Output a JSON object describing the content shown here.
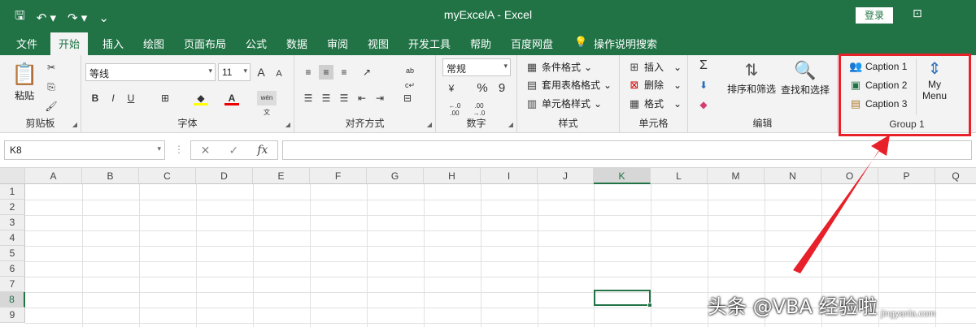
{
  "titlebar": {
    "title": "myExcelA  -  Excel",
    "login_label": "登录"
  },
  "tabs": [
    "文件",
    "开始",
    "插入",
    "绘图",
    "页面布局",
    "公式",
    "数据",
    "审阅",
    "视图",
    "开发工具",
    "帮助",
    "百度网盘",
    "操作说明搜索"
  ],
  "active_tab": "开始",
  "ribbon": {
    "clipboard": {
      "paste": "粘贴",
      "label": "剪贴板"
    },
    "font": {
      "name": "等线",
      "size": "11",
      "label": "字体",
      "grow": "A",
      "shrink": "A",
      "bold": "B",
      "italic": "I",
      "underline": "U",
      "phonetic": "wén 文"
    },
    "alignment": {
      "label": "对齐方式",
      "wrap": "ab c↵"
    },
    "number": {
      "format": "常规",
      "percent": "%",
      "comma": "9",
      "label": "数字",
      "inc": "←.0 .00",
      "dec": ".00 →.0"
    },
    "styles": {
      "cond": "条件格式",
      "table": "套用表格格式",
      "cell": "单元格样式",
      "label": "样式"
    },
    "cells": {
      "insert": "插入",
      "delete": "删除",
      "format": "格式",
      "label": "单元格"
    },
    "editing": {
      "sum": "Σ",
      "sort": "排序和筛选",
      "find": "查找和选择",
      "label": "编辑"
    },
    "custom": {
      "caption1": "Caption 1",
      "caption2": "Caption 2",
      "caption3": "Caption 3",
      "menu_line1": "My",
      "menu_line2": "Menu",
      "label": "Group 1"
    }
  },
  "formula_bar": {
    "name_box": "K8",
    "fx": "fx",
    "value": ""
  },
  "sheet": {
    "columns": [
      "A",
      "B",
      "C",
      "D",
      "E",
      "F",
      "G",
      "H",
      "I",
      "J",
      "K",
      "L",
      "M",
      "N",
      "O",
      "P",
      "Q"
    ],
    "rows": [
      "1",
      "2",
      "3",
      "4",
      "5",
      "6",
      "7",
      "8",
      "9"
    ],
    "active_cell": "K8",
    "accent_color": "#217346"
  },
  "annotation": {
    "color": "#e8202a"
  },
  "watermark": {
    "text": "头条 @VBA 经验啦",
    "small": "jingyanla.com"
  }
}
